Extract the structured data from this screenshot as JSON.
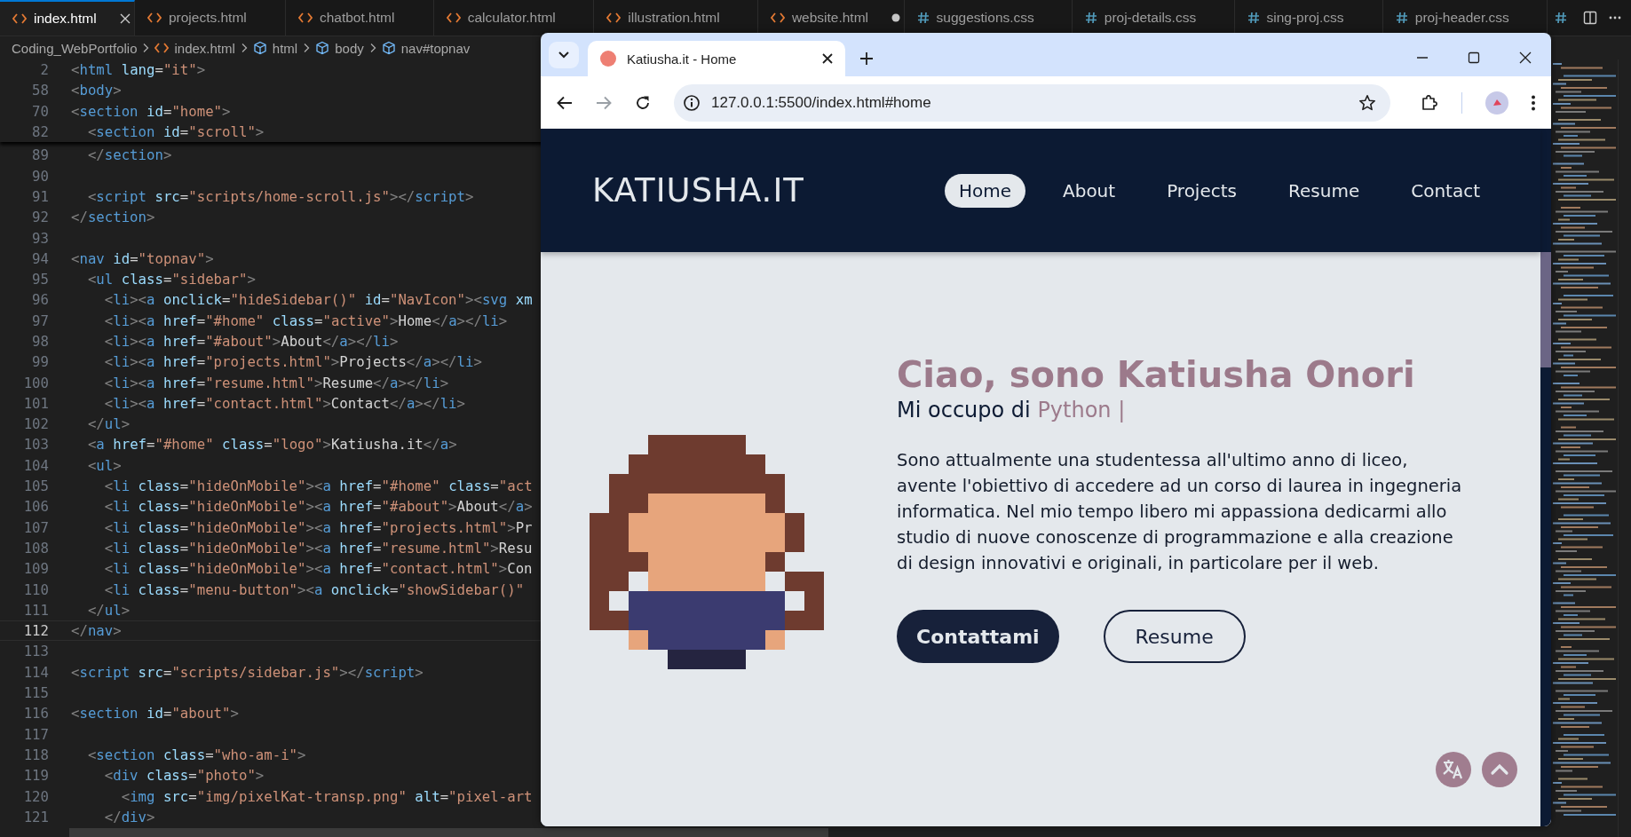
{
  "editor": {
    "tabs": [
      {
        "label": "index.html",
        "kind": "html",
        "selected": true,
        "modified": false
      },
      {
        "label": "projects.html",
        "kind": "html",
        "selected": false,
        "modified": false
      },
      {
        "label": "chatbot.html",
        "kind": "html",
        "selected": false,
        "modified": false
      },
      {
        "label": "calculator.html",
        "kind": "html",
        "selected": false,
        "modified": false
      },
      {
        "label": "illustration.html",
        "kind": "html",
        "selected": false,
        "modified": false
      },
      {
        "label": "website.html",
        "kind": "html",
        "selected": false,
        "modified": true
      },
      {
        "label": "suggestions.css",
        "kind": "css",
        "selected": false,
        "modified": false
      },
      {
        "label": "proj-details.css",
        "kind": "css",
        "selected": false,
        "modified": false
      },
      {
        "label": "sing-proj.css",
        "kind": "css",
        "selected": false,
        "modified": false
      },
      {
        "label": "proj-header.css",
        "kind": "css",
        "selected": false,
        "modified": false
      },
      {
        "kind": "css",
        "selected": false,
        "modified": false
      }
    ],
    "breadcrumbs": [
      {
        "label": "Coding_WebPortfolio",
        "kind": "folder"
      },
      {
        "label": "index.html",
        "kind": "file"
      },
      {
        "label": "html",
        "kind": "element"
      },
      {
        "label": "body",
        "kind": "element"
      },
      {
        "label": "nav#topnav",
        "kind": "element"
      }
    ],
    "sticky_lines": [
      {
        "number": "2",
        "text": "<html lang=\"it\">"
      },
      {
        "number": "58",
        "text": "<body>"
      },
      {
        "number": "70",
        "text": "<section id=\"home\">"
      },
      {
        "number": "82",
        "text": "  <section id=\"scroll\">"
      }
    ],
    "lines": [
      {
        "number": "89",
        "text": "  </section>",
        "current": false
      },
      {
        "number": "90",
        "current": false
      },
      {
        "number": "91",
        "text": "  <script src=\"scripts/home-scroll.js\"></script>",
        "current": false
      },
      {
        "number": "92",
        "text": "</section>",
        "current": false
      },
      {
        "number": "93",
        "current": false
      },
      {
        "number": "94",
        "text": "<nav id=\"topnav\">",
        "current": false
      },
      {
        "number": "95",
        "text": "  <ul class=\"sidebar\">",
        "current": false
      },
      {
        "number": "96",
        "text": "    <li><a onclick=\"hideSidebar()\" id=\"NavIcon\"><svg xm",
        "current": false
      },
      {
        "number": "97",
        "text": "    <li><a href=\"#home\" class=\"active\">Home</a></li>",
        "current": false
      },
      {
        "number": "98",
        "text": "    <li><a href=\"#about\">About</a></li>",
        "current": false
      },
      {
        "number": "99",
        "text": "    <li><a href=\"projects.html\">Projects</a></li>",
        "current": false
      },
      {
        "number": "100",
        "text": "    <li><a href=\"resume.html\">Resume</a></li>",
        "current": false
      },
      {
        "number": "101",
        "text": "    <li><a href=\"contact.html\">Contact</a></li>",
        "current": false
      },
      {
        "number": "102",
        "text": "  </ul>",
        "current": false
      },
      {
        "number": "103",
        "text": "  <a href=\"#home\" class=\"logo\">Katiusha.it</a>",
        "current": false
      },
      {
        "number": "104",
        "text": "  <ul>",
        "current": false
      },
      {
        "number": "105",
        "text": "    <li class=\"hideOnMobile\"><a href=\"#home\" class=\"act",
        "current": false
      },
      {
        "number": "106",
        "text": "    <li class=\"hideOnMobile\"><a href=\"#about\">About</a>",
        "current": false
      },
      {
        "number": "107",
        "text": "    <li class=\"hideOnMobile\"><a href=\"projects.html\">Pr",
        "current": false
      },
      {
        "number": "108",
        "text": "    <li class=\"hideOnMobile\"><a href=\"resume.html\">Resu",
        "current": false
      },
      {
        "number": "109",
        "text": "    <li class=\"hideOnMobile\"><a href=\"contact.html\">Con",
        "current": false
      },
      {
        "number": "110",
        "text": "    <li class=\"menu-button\"><a onclick=\"showSidebar()\"",
        "current": false
      },
      {
        "number": "111",
        "text": "  </ul>",
        "current": false
      },
      {
        "number": "112",
        "text": "</nav>",
        "current": true
      },
      {
        "number": "113",
        "current": false
      },
      {
        "number": "114",
        "text": "<script src=\"scripts/sidebar.js\"></script>",
        "current": false
      },
      {
        "number": "115",
        "current": false
      },
      {
        "number": "116",
        "text": "<section id=\"about\">",
        "current": false
      },
      {
        "number": "117",
        "current": false
      },
      {
        "number": "118",
        "text": "  <section class=\"who-am-i\">",
        "current": false
      },
      {
        "number": "119",
        "text": "    <div class=\"photo\">",
        "current": false
      },
      {
        "number": "120",
        "text": "      <img src=\"img/pixelKat-transp.png\" alt=\"pixel-art",
        "current": false
      },
      {
        "number": "121",
        "text": "    </div>",
        "current": false
      }
    ]
  },
  "browser": {
    "tab": {
      "title": "Katiusha.it - Home",
      "selected": true
    },
    "url": "127.0.0.1:5500/index.html#home",
    "page": {
      "logo": "KATIUSHA.IT",
      "nav": [
        {
          "label": "Home",
          "selected": true
        },
        {
          "label": "About",
          "selected": false
        },
        {
          "label": "Projects",
          "selected": false
        },
        {
          "label": "Resume",
          "selected": false
        },
        {
          "label": "Contact",
          "selected": false
        }
      ],
      "heading": "Ciao, sono Katiusha Onori",
      "subtitle": "Mi occupo di",
      "subtitle_typed": "Python |",
      "paragraph": "Sono attualmente una studentessa all'ultimo anno di liceo, avente l'obiettivo di accedere ad un corso di laurea in ingegneria informatica. Nel mio tempo libero mi appassiona dedicarmi allo studio di nuove conoscenze di programmazione e alla creazione di design innovativi e originali, in particolare per il web.",
      "buttons": [
        {
          "label": "Contattami",
          "kind": "primary"
        },
        {
          "label": "Resume",
          "kind": "outline"
        }
      ]
    }
  }
}
